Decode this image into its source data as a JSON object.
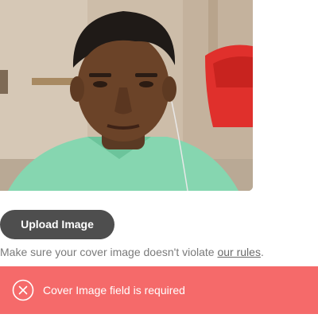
{
  "cover": {
    "image_alt": "cover-image"
  },
  "upload": {
    "button_label": "Upload Image"
  },
  "help": {
    "prefix": "Make sure your cover image doesn't violate ",
    "link_text": "our rules",
    "suffix": "."
  },
  "error": {
    "message": "Cover Image field is required",
    "icon": "close-circle-icon"
  },
  "colors": {
    "button_bg": "#4e4e4e",
    "error_bg": "#f56a6a",
    "help_text": "#7a7a7a"
  }
}
